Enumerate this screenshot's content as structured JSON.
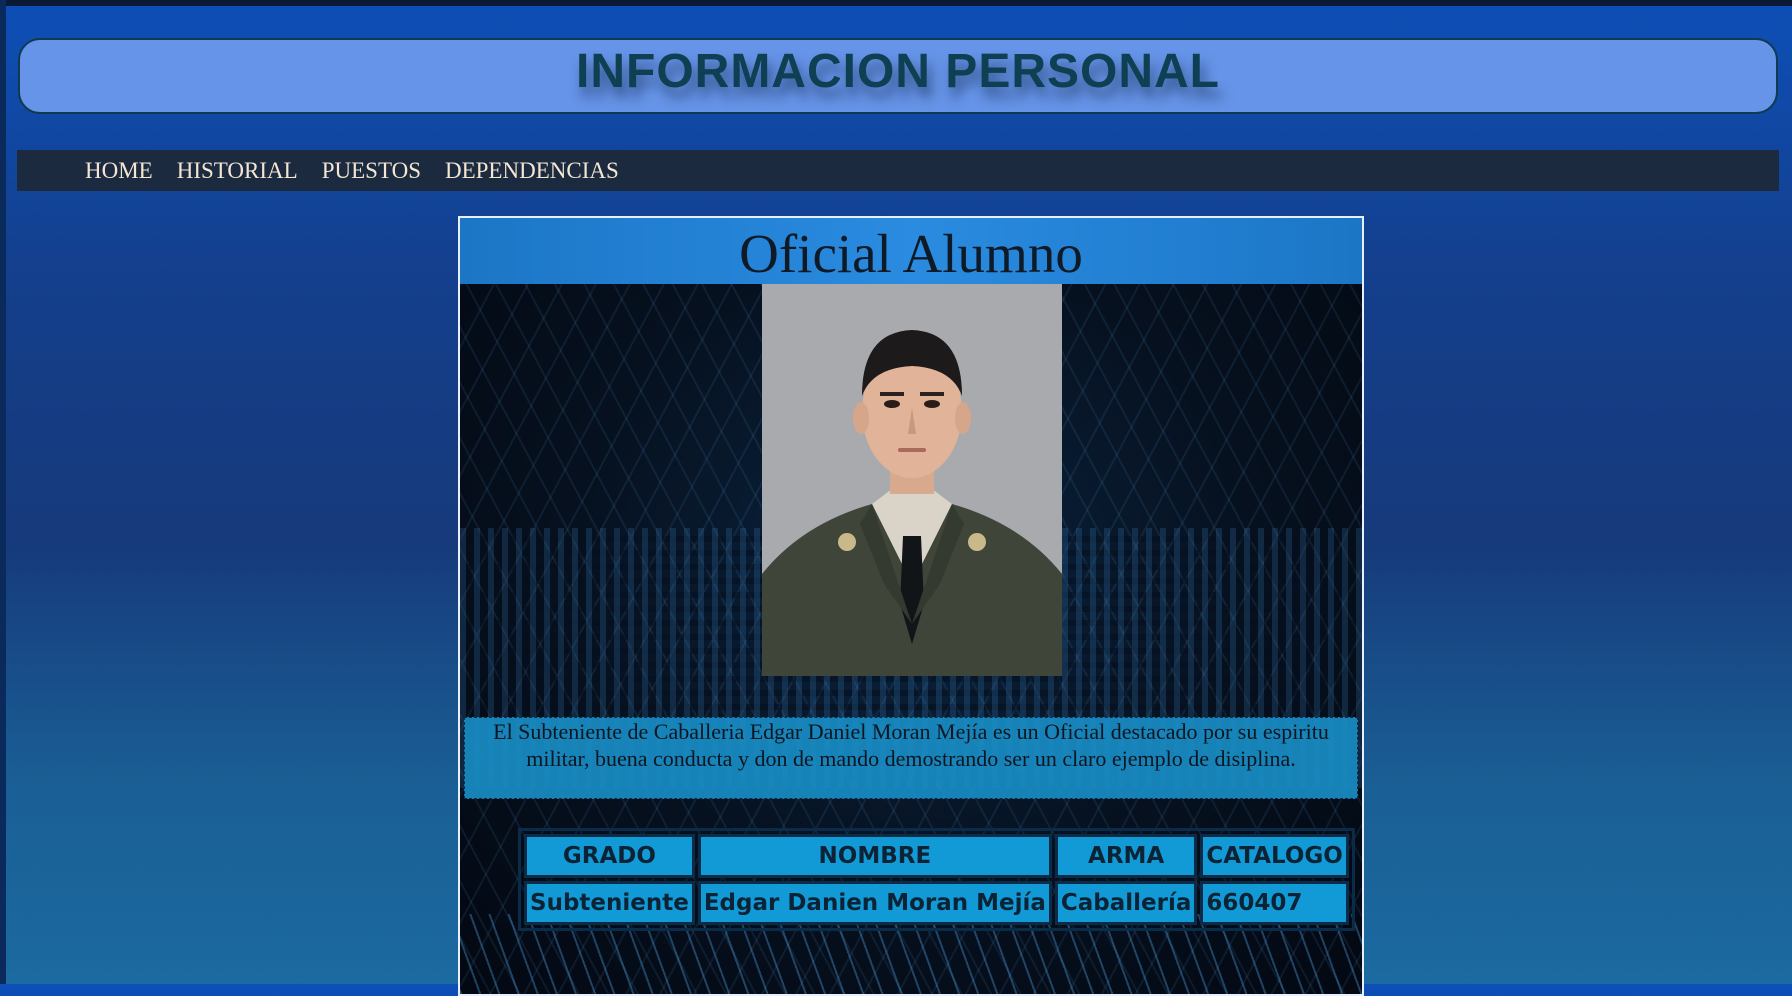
{
  "header": {
    "title": "INFORMACION PERSONAL"
  },
  "nav": {
    "items": [
      {
        "label": "HOME"
      },
      {
        "label": "HISTORIAL"
      },
      {
        "label": "PUESTOS"
      },
      {
        "label": "DEPENDENCIAS"
      }
    ]
  },
  "card": {
    "title": "Oficial Alumno",
    "description": "El Subteniente de Caballeria Edgar Daniel Moran Mejía es un Oficial destacado por su espiritu militar, buena conducta y don de mando demostrando ser un claro ejemplo de disiplina.",
    "table": {
      "headers": [
        "GRADO",
        "NOMBRE",
        "ARMA",
        "CATALOGO"
      ],
      "row": [
        "Subteniente",
        "Edgar Danien Moran Mejía",
        "Caballería",
        "660407"
      ]
    }
  },
  "colors": {
    "header_bg": "#6694e8",
    "header_text": "#0f3f52",
    "nav_bg": "#1b2a3f",
    "nav_text": "#f4e6d2",
    "card_title_bar": "#2a8be0",
    "table_cell": "#129ad6"
  }
}
